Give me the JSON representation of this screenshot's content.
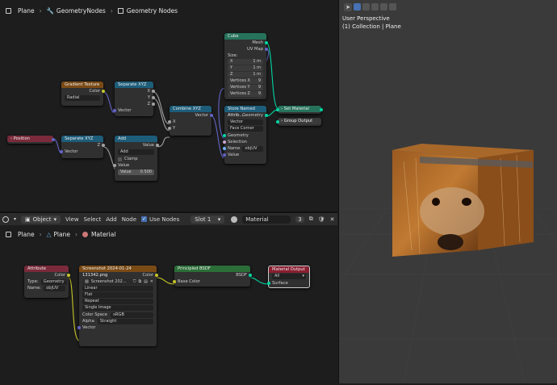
{
  "top_breadcrumb": {
    "items": [
      "Plane",
      "GeometryNodes",
      "Geometry Nodes"
    ]
  },
  "bottom_breadcrumb": {
    "items": [
      "Plane",
      "Plane",
      "Material"
    ]
  },
  "shader_header": {
    "object_mode": "Object",
    "menus": [
      "View",
      "Select",
      "Add",
      "Node"
    ],
    "use_nodes": "Use Nodes",
    "slot": "Slot 1",
    "material": "Material",
    "users": "3"
  },
  "viewport": {
    "title": "User Perspective",
    "subtitle": "(1) Collection | Plane"
  },
  "geo_nodes": {
    "gradient": {
      "title": "Gradient Texture",
      "color": "Color",
      "mode": "Radial"
    },
    "sep1": {
      "title": "Separate XYZ",
      "x": "X",
      "y": "Y",
      "z": "Z",
      "vector": "Vector"
    },
    "combine": {
      "title": "Combine XYZ",
      "vector": "Vector",
      "x": "X",
      "y": "Y",
      "z": "Z"
    },
    "cube": {
      "title": "Cube",
      "mesh": "Mesh",
      "uvmap": "UV Map",
      "size": "Size:",
      "sx": "X",
      "sy": "Y",
      "sz": "Z",
      "vx": "1 m",
      "vy": "1 m",
      "vz": "1 m",
      "verts_x": "Vertices X",
      "verts_y": "Vertices Y",
      "verts_z": "Vertices Z",
      "vvx": "9",
      "vvy": "9",
      "vvz": "9"
    },
    "store": {
      "title": "Store Named Attrib...",
      "geometry": "Geometry",
      "type": "Vector",
      "domain": "Face Corner",
      "geo_in": "Geometry",
      "selection": "Selection",
      "name_label": "Name",
      "name_value": "objUV",
      "value": "Value"
    },
    "setmat": {
      "title": "Set Material"
    },
    "group_output": {
      "title": "Group Output"
    },
    "position": {
      "title": "Position"
    },
    "sep2": {
      "title": "Separate XYZ",
      "z": "Z",
      "vector": "Vector"
    },
    "add": {
      "title": "Add",
      "value": "Value",
      "op": "Add",
      "clamp": "Clamp",
      "value_in": "Value",
      "value_field": "Value",
      "value_num": "0.500"
    }
  },
  "shader_nodes": {
    "attribute": {
      "title": "Attribute",
      "color": "Color",
      "type_label": "Type:",
      "type_value": "Geometry",
      "name_label": "Name:",
      "name_value": "objUV"
    },
    "image": {
      "title": "Screenshot 2024-01-24 131342.png",
      "color": "Color",
      "img_name": "Screenshot 202...",
      "interp": "Linear",
      "proj": "Flat",
      "ext": "Repeat",
      "source": "Single Image",
      "cs_label": "Color Space",
      "cs_value": "sRGB",
      "alpha_label": "Alpha",
      "alpha_value": "Straight",
      "vector": "Vector"
    },
    "bsdf": {
      "title": "Principled BSDF",
      "bsdf": "BSDF",
      "base_color": "Base Color"
    },
    "output": {
      "title": "Material Output",
      "target": "All",
      "surface": "Surface"
    }
  },
  "colors": {
    "attr_header": "#7a2a3a",
    "geo_header": "#1d5d7a",
    "tex_header": "#7a4a15",
    "shader_header": "#2b6e37",
    "output_header": "#8a1e30",
    "green_header": "#26725a"
  }
}
